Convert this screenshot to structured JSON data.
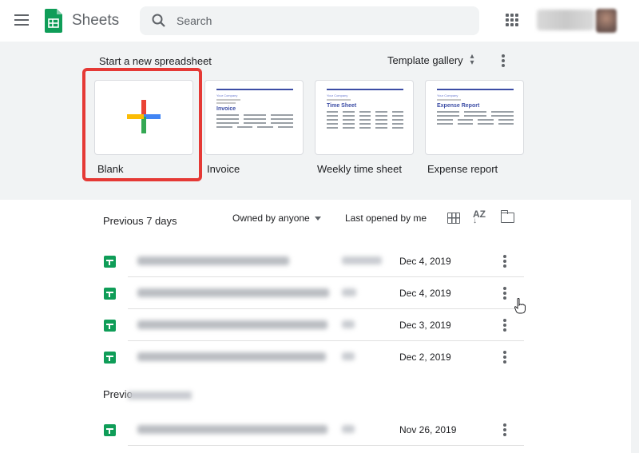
{
  "header": {
    "app_title": "Sheets",
    "search_placeholder": "Search"
  },
  "templates": {
    "section_title": "Start a new spreadsheet",
    "gallery_label": "Template gallery",
    "items": [
      {
        "label": "Blank"
      },
      {
        "label": "Invoice",
        "preview_company": "Your Company",
        "preview_heading": "Invoice"
      },
      {
        "label": "Weekly time sheet",
        "preview_company": "Your Company",
        "preview_heading": "Time Sheet"
      },
      {
        "label": "Expense report",
        "preview_company": "Your Company",
        "preview_heading": "Expense Report"
      }
    ]
  },
  "files": {
    "section_title": "Previous 7 days",
    "owner_filter": "Owned by anyone",
    "sort_label": "Last opened by me",
    "rows": [
      {
        "date": "Dec 4, 2019"
      },
      {
        "date": "Dec 4, 2019"
      },
      {
        "date": "Dec 3, 2019"
      },
      {
        "date": "Dec 2, 2019"
      }
    ],
    "section2_title_visible": "Previo",
    "rows2": [
      {
        "date": "Nov 26, 2019"
      }
    ]
  },
  "colors": {
    "accent_green": "#0f9d58",
    "highlight_red": "#e53935",
    "band_background": "#f1f3f4"
  },
  "icons": [
    "menu-icon",
    "sheets-logo",
    "search-icon",
    "apps-icon",
    "more-vert-icon",
    "grid-view-icon",
    "sort-az-icon",
    "folder-icon",
    "spreadsheet-icon"
  ]
}
